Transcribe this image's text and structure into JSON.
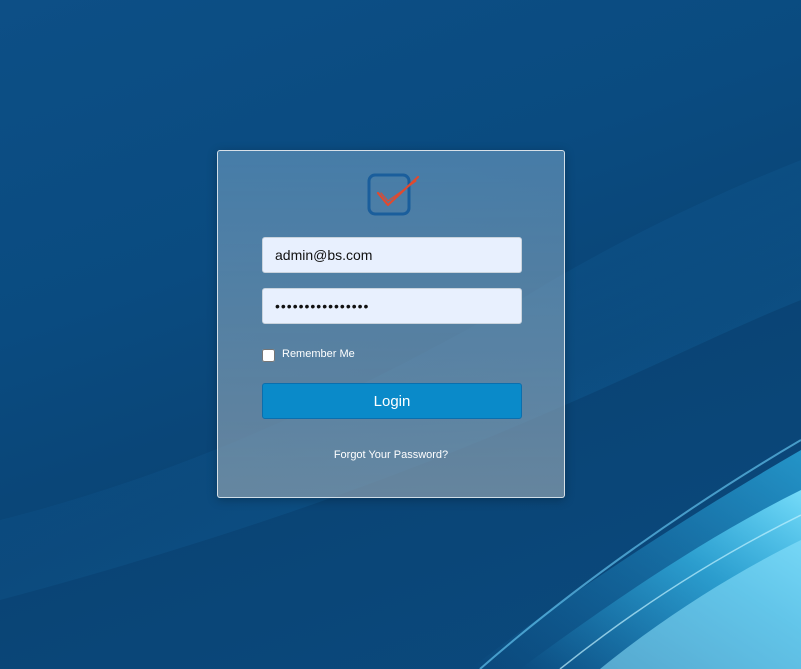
{
  "login": {
    "logo_icon": "checkbox-check-icon",
    "email_value": "admin@bs.com",
    "password_value": "••••••••••••••••",
    "remember_label": "Remember Me",
    "remember_checked": false,
    "login_label": "Login",
    "forgot_label": "Forgot Your Password?"
  },
  "colors": {
    "background": "#0b4a7e",
    "button": "#0a8ac9",
    "input_bg": "#e8f0fe",
    "logo_box": "#1a5e9c",
    "logo_check": "#e04a2f"
  }
}
